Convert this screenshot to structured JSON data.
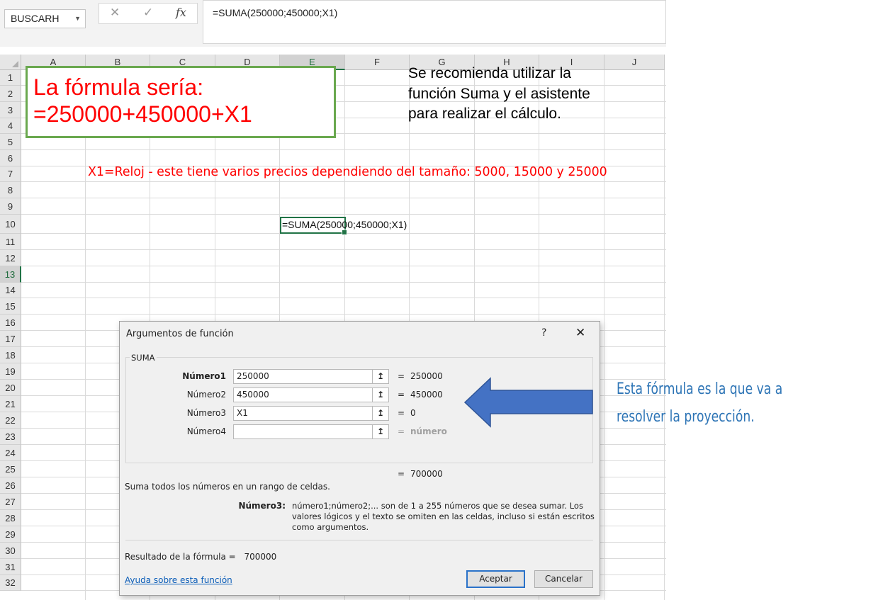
{
  "formula_bar": {
    "name_box": "BUSCARH",
    "cancel_icon": "✕",
    "confirm_icon": "✓",
    "fx_icon": "fx",
    "formula": "=SUMA(250000;450000;X1)"
  },
  "grid": {
    "columns": [
      "A",
      "B",
      "C",
      "D",
      "E",
      "F",
      "G",
      "H",
      "I",
      "J"
    ],
    "selected_column": "E",
    "rows": [
      "1",
      "2",
      "3",
      "4",
      "5",
      "6",
      "7",
      "8",
      "9",
      "10",
      "11",
      "12",
      "13",
      "14",
      "15",
      "16",
      "17",
      "18",
      "19",
      "20",
      "21",
      "22",
      "23",
      "24",
      "25",
      "26",
      "27",
      "28",
      "29",
      "30",
      "31",
      "32"
    ],
    "selected_row": "13"
  },
  "sheet": {
    "formula_box": {
      "line1": "La fórmula sería:",
      "line2": "=250000+450000+X1"
    },
    "recommendation": {
      "line1": "Se recomienda utilizar la",
      "line2": "función Suma y el asistente",
      "line3": "para realizar el cálculo."
    },
    "x1_note": "X1=Reloj - este tiene varios precios dependiendo del tamaño: 5000, 15000 y 25000",
    "active_cell_content": "=SUMA(250000;450000;X1)"
  },
  "dialog": {
    "title": "Argumentos de función",
    "help": "?",
    "close": "✕",
    "group_label": "SUMA",
    "arguments": [
      {
        "label": "Número1",
        "value": "250000",
        "result": "250000",
        "bold": true
      },
      {
        "label": "Número2",
        "value": "450000",
        "result": "450000",
        "bold": false
      },
      {
        "label": "Número3",
        "value": "X1",
        "result": "0",
        "bold": false
      },
      {
        "label": "Número4",
        "value": "",
        "result": "número",
        "bold": false
      }
    ],
    "equals": "=",
    "collapse_icon": "↥",
    "total": "700000",
    "function_description": "Suma todos los números en un rango de celdas.",
    "arg_help_name": "Número3:",
    "arg_help_text": "número1;número2;... son de 1 a 255 números que se desea sumar. Los valores lógicos y el texto se omiten en las celdas, incluso si están escritos como argumentos.",
    "result_label": "Resultado de la fórmula =",
    "result_value": "700000",
    "help_link": "Ayuda sobre esta función",
    "ok_button": "Aceptar",
    "cancel_button": "Cancelar"
  },
  "annotation": {
    "line1": "Esta fórmula  es la que va a",
    "line2": "resolver  la proyección.",
    "arrow_color": "#4472c4"
  }
}
